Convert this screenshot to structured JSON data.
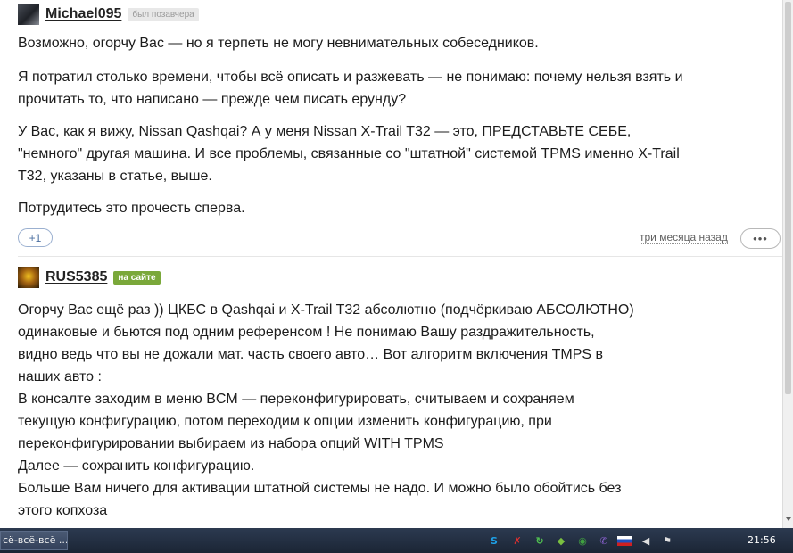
{
  "comments": [
    {
      "username": "Michael095",
      "status": "был позавчера",
      "paragraphs": [
        "Возможно, огорчу Вас — но я терпеть не могу невнимательных собеседников.",
        "Я потратил столько времени, чтобы всё описать и разжевать — не понимаю: почему нельзя взять и прочитать то, что написано — прежде чем писать ерунду?",
        "У Вас, как я вижу, Nissan Qashqai? А у меня Nissan X-Trail T32 — это, ПРЕДСТАВЬТЕ СЕБЕ, \"немного\" другая машина. И все проблемы, связанные со \"штатной\" системой TPMS именно X-Trail T32, указаны в статье, выше.",
        "Потрудитесь это прочесть сперва."
      ],
      "like_label": "+1",
      "time": "три месяца назад",
      "more_label": "•••"
    },
    {
      "username": "RUS5385",
      "status": "на сайте",
      "lines": [
        "Огорчу Вас ещё раз )) ЦКБС в Qashqai и X-Trail T32 абсолютно (подчёркиваю АБСОЛЮТНО)",
        "одинаковые и бьются под одним референсом ! Не понимаю Вашу раздражительность,",
        "видно ведь что вы не дожали мат. часть своего авто… Вот алгоритм включения TMPS в",
        "наших авто :",
        "В консалте заходим в меню BCM — переконфигурировать, считываем и сохраняем",
        "текущую конфигурацию, потом переходим к опции изменить конфигурацию, при",
        "переконфигурировании выбираем из набора опций WITH TPMS",
        "Далее — сохранить конфигурацию.",
        "Больше Вам ничего для активации штатной системы не надо. И можно было обойтись без",
        "этого копхоза"
      ]
    }
  ],
  "taskbar": {
    "task_label": "сё-всё-всё ...",
    "tray_icons": [
      {
        "name": "skype-icon",
        "glyph": "S",
        "color": "#1ea0e6"
      },
      {
        "name": "antivirus-icon",
        "glyph": "✗",
        "color": "#e03030"
      },
      {
        "name": "sync-icon",
        "glyph": "↻",
        "color": "#50c050"
      },
      {
        "name": "shield-icon",
        "glyph": "◆",
        "color": "#7ac040"
      },
      {
        "name": "network-icon",
        "glyph": "◉",
        "color": "#40a040"
      },
      {
        "name": "viber-icon",
        "glyph": "✆",
        "color": "#8a60d0"
      },
      {
        "name": "flag-ru-icon",
        "glyph": "",
        "color": "#d02020"
      },
      {
        "name": "speaker-icon",
        "glyph": "◀",
        "color": "#e0e0e0"
      },
      {
        "name": "flag-notification-icon",
        "glyph": "⚑",
        "color": "#e0e0e0"
      }
    ],
    "clock": "21:56"
  }
}
